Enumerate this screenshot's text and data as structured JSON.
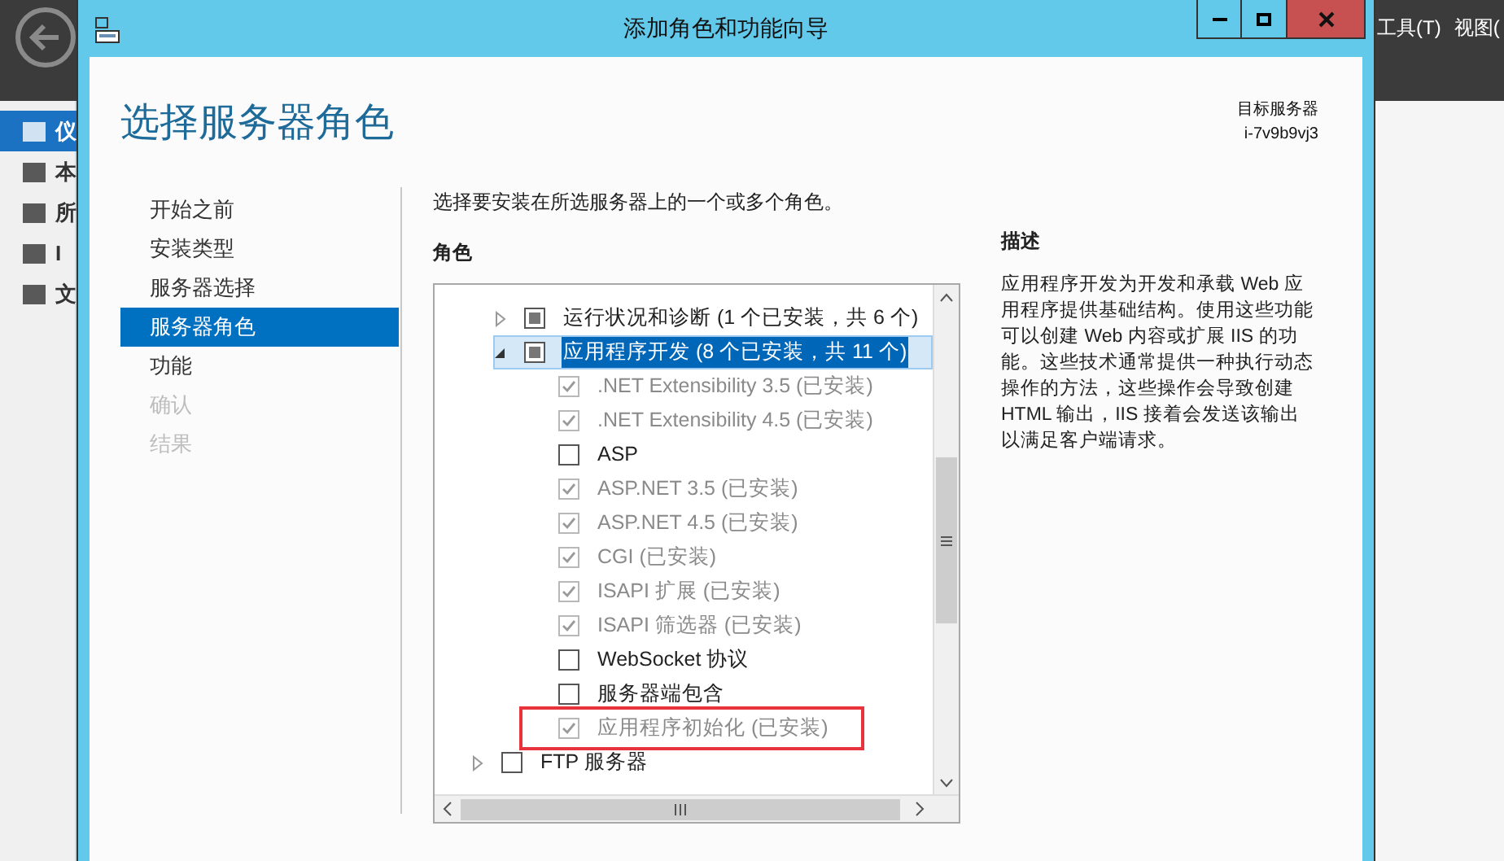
{
  "background": {
    "menu": [
      "工具(T)",
      "视图("
    ],
    "sidebar": [
      {
        "label": "仪",
        "selected": true
      },
      {
        "label": "本",
        "selected": false
      },
      {
        "label": "所",
        "selected": false
      },
      {
        "label": "I",
        "selected": false
      },
      {
        "label": "文",
        "selected": false
      }
    ]
  },
  "window": {
    "title": "添加角色和功能向导"
  },
  "page_title": "选择服务器角色",
  "target": {
    "label": "目标服务器",
    "value": "i-7v9b9vj3"
  },
  "steps": [
    {
      "label": "开始之前",
      "selected": false,
      "disabled": false
    },
    {
      "label": "安装类型",
      "selected": false,
      "disabled": false
    },
    {
      "label": "服务器选择",
      "selected": false,
      "disabled": false
    },
    {
      "label": "服务器角色",
      "selected": true,
      "disabled": false
    },
    {
      "label": "功能",
      "selected": false,
      "disabled": false
    },
    {
      "label": "确认",
      "selected": false,
      "disabled": true
    },
    {
      "label": "结果",
      "selected": false,
      "disabled": true
    }
  ],
  "instruction": "选择要安装在所选服务器上的一个或多个角色。",
  "roles_heading": "角色",
  "roles": [
    {
      "kind": "sub",
      "label": "运行状况和诊断 (1 个已安装，共 6 个)",
      "checked": false,
      "partial": true,
      "expanded": false,
      "selected": false,
      "disabled": false,
      "highlighted": false
    },
    {
      "kind": "sub",
      "label": "应用程序开发 (8 个已安装，共 11 个)",
      "checked": false,
      "partial": true,
      "expanded": true,
      "selected": true,
      "disabled": false,
      "highlighted": false,
      "children": [
        {
          "kind": "leaf",
          "label": ".NET Extensibility 3.5 (已安装)",
          "checked": true,
          "selected": false,
          "disabled": true,
          "highlighted": false
        },
        {
          "kind": "leaf",
          "label": ".NET Extensibility 4.5 (已安装)",
          "checked": true,
          "selected": false,
          "disabled": true,
          "highlighted": false
        },
        {
          "kind": "leaf",
          "label": "ASP",
          "checked": false,
          "selected": false,
          "disabled": false,
          "highlighted": false
        },
        {
          "kind": "leaf",
          "label": "ASP.NET 3.5 (已安装)",
          "checked": true,
          "selected": false,
          "disabled": true,
          "highlighted": false
        },
        {
          "kind": "leaf",
          "label": "ASP.NET 4.5 (已安装)",
          "checked": true,
          "selected": false,
          "disabled": true,
          "highlighted": false
        },
        {
          "kind": "leaf",
          "label": "CGI (已安装)",
          "checked": true,
          "selected": false,
          "disabled": true,
          "highlighted": false
        },
        {
          "kind": "leaf",
          "label": "ISAPI 扩展 (已安装)",
          "checked": true,
          "selected": false,
          "disabled": true,
          "highlighted": false
        },
        {
          "kind": "leaf",
          "label": "ISAPI 筛选器 (已安装)",
          "checked": true,
          "selected": false,
          "disabled": true,
          "highlighted": false
        },
        {
          "kind": "leaf",
          "label": "WebSocket 协议",
          "checked": false,
          "selected": false,
          "disabled": false,
          "highlighted": false
        },
        {
          "kind": "leaf",
          "label": "服务器端包含",
          "checked": false,
          "selected": false,
          "disabled": false,
          "highlighted": false
        },
        {
          "kind": "leaf",
          "label": "应用程序初始化 (已安装)",
          "checked": true,
          "selected": false,
          "disabled": true,
          "highlighted": true
        }
      ]
    },
    {
      "kind": "role",
      "label": "FTP 服务器",
      "checked": false,
      "expanded": false,
      "selected": false,
      "disabled": false,
      "highlighted": false
    }
  ],
  "description": {
    "heading": "描述",
    "text": "应用程序开发为开发和承载 Web 应用程序提供基础结构。使用这些功能可以创建 Web 内容或扩展 IIS 的功能。这些技术通常提供一种执行动态操作的方法，这些操作会导致创建 HTML 输出，IIS 接着会发送该输出以满足客户端请求。"
  }
}
